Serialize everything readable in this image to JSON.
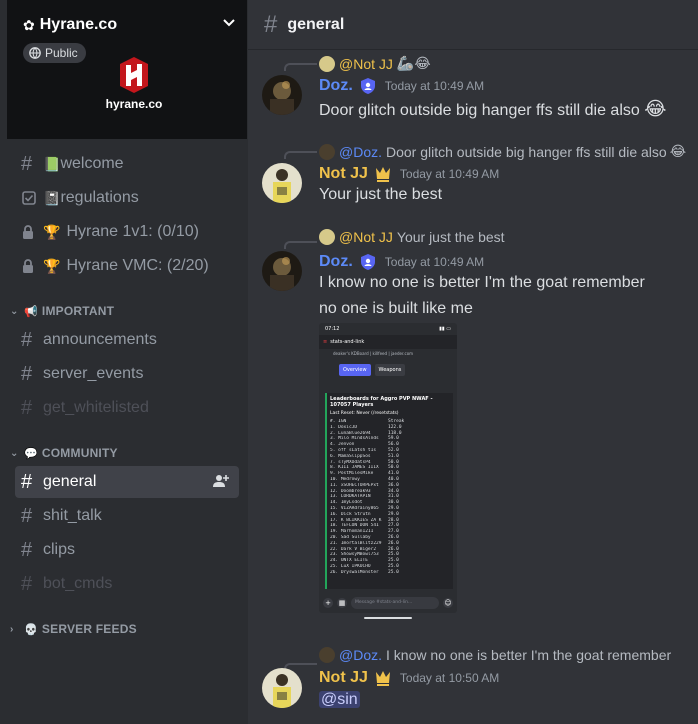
{
  "server": {
    "name": "Hyrane.co",
    "visibility": "Public",
    "logo_text": "hyrane.co"
  },
  "channels_top": [
    {
      "label": "welcome",
      "icon": "hash",
      "emoji": "📗"
    },
    {
      "label": "regulations",
      "icon": "rules-checkbox",
      "emoji": "📓"
    },
    {
      "label": "Hyrane 1v1: (0/10)",
      "icon": "lock",
      "emoji": "🏆"
    },
    {
      "label": "Hyrane VMC: (2/20)",
      "icon": "lock",
      "emoji": "🏆"
    }
  ],
  "categories": {
    "important": {
      "label": "IMPORTANT",
      "emoji": "📢"
    },
    "community": {
      "label": "COMMUNITY",
      "emoji": "💬"
    },
    "server_feeds": {
      "label": "SERVER FEEDS",
      "emoji": "💀"
    }
  },
  "channels_important": [
    {
      "label": "announcements"
    },
    {
      "label": "server_events"
    },
    {
      "label": "get_whitelisted"
    }
  ],
  "channels_community": [
    {
      "label": "general"
    },
    {
      "label": "shit_talk"
    },
    {
      "label": "clips"
    },
    {
      "label": "bot_cmds"
    }
  ],
  "header": {
    "channel": "general"
  },
  "colors": {
    "doz_name": "#5c8af7",
    "notjj_name": "#f0c24b",
    "mention_bg": "#3c4270",
    "accent": "#5865f2",
    "online_green": "#23a55a"
  },
  "messages": [
    {
      "reply_name": "@Not JJ",
      "reply_text": "",
      "reply_emoji": "🦾😂",
      "author": "Doz.",
      "time": "Today at 10:49 AM",
      "text": "Door glitch outside big hanger ffs still die also",
      "text_emoji": "😂"
    },
    {
      "reply_name": "@Doz.",
      "reply_text": "Door glitch outside big hanger ffs still die also",
      "reply_emoji": "😂",
      "author": "Not JJ",
      "time": "Today at 10:49 AM",
      "text": "Your just the best"
    },
    {
      "reply_name": "@Not JJ",
      "reply_text": "Your just the best",
      "author": "Doz.",
      "time": "Today at 10:49 AM",
      "lines": [
        "I know no one is better I'm the goat remember",
        "no one is built like me"
      ]
    },
    {
      "reply_name": "@Doz.",
      "reply_text": "I know no one is better I'm the goat remember",
      "author": "Not JJ",
      "time": "Today at 10:50 AM",
      "mention": "@sin"
    }
  ],
  "screenshot": {
    "clock": "07:12",
    "channel": "stats-and-link",
    "link_text": "deaker's KDBoard | killfeed | jaeder.com",
    "tabs": [
      "Overview",
      "Weapons"
    ],
    "board_title": "Leaderboards for Aggro PVP NWAF - 107057 Players",
    "board_sub": "Last Reset: Never (/resetstats)",
    "columns": [
      "#. IGN",
      "Streak"
    ],
    "rows": [
      [
        "1. DoxicJD",
        "122.0"
      ],
      [
        "2. LunaBlue2694",
        "118.0"
      ],
      [
        "3. Milo MindsAlnds",
        "59.0"
      ],
      [
        "4. Jenvon",
        "56.0"
      ],
      [
        "5. off sLatsh t1s",
        "52.0"
      ],
      [
        "6. MamaSlippSos",
        "51.0"
      ],
      [
        "7. sTyMXOdatsP4",
        "50.0"
      ],
      [
        "8. KIII JAMES IIIX",
        "50.0"
      ],
      [
        "9. PostMilesMike",
        "41.0"
      ],
      [
        "10. Medrowy",
        "40.0"
      ],
      [
        "11. xSOHECTORPEPxt",
        "36.0"
      ],
      [
        "12. Doombreak93",
        "34.0"
      ],
      [
        "13. LORDKATAPIN",
        "31.0"
      ],
      [
        "14. ImyLsdot",
        "30.0"
      ],
      [
        "15. VIZARdrainy865",
        "29.0"
      ],
      [
        "16. Dick Strutn",
        "29.0"
      ],
      [
        "17. K BLIKKIES ZA K",
        "28.0"
      ],
      [
        "18. TEFLON DON 541",
        "27.0"
      ],
      [
        "19. Marhoman1211",
        "27.0"
      ],
      [
        "20. Sad Sullaby",
        "26.0"
      ],
      [
        "21. ImortalBlitz229",
        "26.0"
      ],
      [
        "22. Dark V Biger2",
        "26.0"
      ],
      [
        "23. ShowsyMBowl753",
        "25.0"
      ],
      [
        "24. UNTX ELITE",
        "25.0"
      ],
      [
        "25. LuX IPKUCHO",
        "25.0"
      ],
      [
        "26. DryswalMonster",
        "25.0"
      ]
    ],
    "input_placeholder": "Message #stats-and-lin..."
  }
}
